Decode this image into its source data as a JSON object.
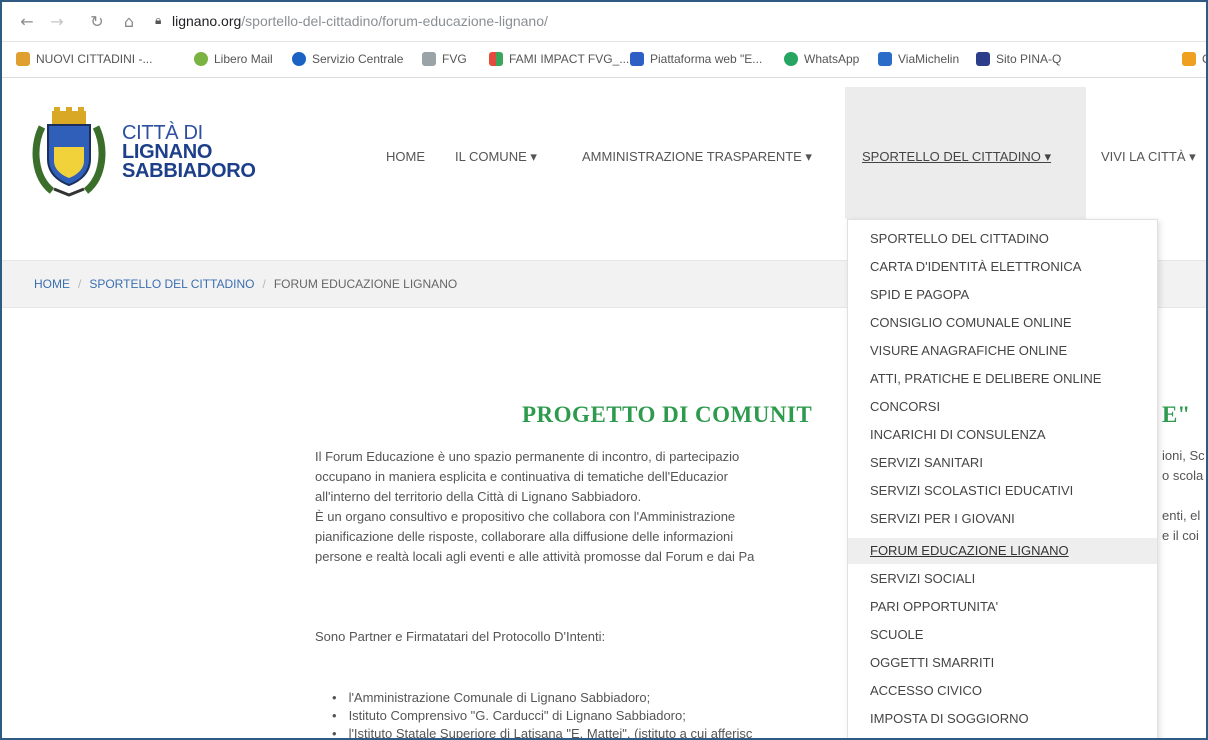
{
  "browser": {
    "back_icon": "arrow-left-icon",
    "forward_icon": "arrow-right-icon",
    "reload_icon": "reload-icon",
    "home_icon": "home-icon",
    "url_host": "lignano.org",
    "url_path": "/sportello-del-cittadino/forum-educazione-lignano/",
    "bookmarks": [
      {
        "label": "NUOVI CITTADINI -...",
        "color": "#e0a030"
      },
      {
        "label": "Libero Mail",
        "color": "#7bb342"
      },
      {
        "label": "Servizio Centrale",
        "color": "#1a63c4"
      },
      {
        "label": "FVG",
        "color": "#9aa3a8"
      },
      {
        "label": "FAMI IMPACT FVG_...",
        "color": "#e54b3c"
      },
      {
        "label": "Piattaforma web \"E...",
        "color": "#2d5fc4"
      },
      {
        "label": "WhatsApp",
        "color": "#25a55f"
      },
      {
        "label": "ViaMichelin",
        "color": "#2a6cc8"
      },
      {
        "label": "Sito PINA-Q",
        "color": "#2c3e8a"
      },
      {
        "label": "C",
        "color": "#f0a020"
      }
    ]
  },
  "site": {
    "logo_line1": "CITTÀ DI",
    "logo_line2": "LIGNANO",
    "logo_line3": "SABBIADORO",
    "menu": [
      {
        "label": "HOME"
      },
      {
        "label": "IL COMUNE ▾"
      },
      {
        "label": "AMMINISTRAZIONE TRASPARENTE ▾"
      },
      {
        "label": "SPORTELLO DEL CITTADINO ▾"
      },
      {
        "label": "VIVI LA CITTÀ ▾"
      }
    ]
  },
  "breadcrumb": {
    "home": "HOME",
    "section": "SPORTELLO DEL CITTADINO",
    "current": "FORUM EDUCAZIONE LIGNANO",
    "separator": "/"
  },
  "dropdown": {
    "items": [
      "SPORTELLO DEL CITTADINO",
      "CARTA D'IDENTITÀ ELETTRONICA",
      "SPID E PAGOPA",
      "CONSIGLIO COMUNALE ONLINE",
      "VISURE ANAGRAFICHE ONLINE",
      "ATTI, PRATICHE E DELIBERE ONLINE",
      "CONCORSI",
      "INCARICHI DI CONSULENZA",
      "SERVIZI SANITARI",
      "SERVIZI SCOLASTICI EDUCATIVI",
      "SERVIZI PER I GIOVANI",
      "FORUM EDUCAZIONE LIGNANO",
      "SERVIZI SOCIALI",
      "PARI OPPORTUNITA'",
      "SCUOLE",
      "OGGETTI SMARRITI",
      "ACCESSO CIVICO",
      "IMPOSTA DI SOGGIORNO"
    ],
    "active_index": 11
  },
  "content": {
    "heading_visible": "PROGETTO DI COMUNIT",
    "heading_tail": "E\"",
    "paragraph_lines": [
      "Il Forum Educazione è uno spazio permanente di incontro, di partecipazio",
      "occupano in maniera esplicita e continuativa di tematiche dell'Educazior",
      "all'interno del territorio della Città di Lignano Sabbiadoro.",
      "È un organo consultivo e propositivo che collabora con l'Amministrazione",
      "pianificazione delle risposte, collaborare alla diffusione delle informazioni",
      "persone e realtà locali agli eventi e alle attività promosse dal Forum e dai Pa"
    ],
    "paragraph_tails": [
      "ioni, Sc",
      "o scola",
      "",
      "enti, el",
      "e il coi",
      ""
    ],
    "partners_intro": "Sono Partner e Firmatatari del Protocollo D'Intenti:",
    "bullets": [
      "l'Amministrazione Comunale di Lignano Sabbiadoro;",
      "Istituto Comprensivo \"G. Carducci\" di Lignano Sabbiadoro;",
      "l'Istituto Statale Superiore di Latisana \"E. Mattei\", (istituto a cui afferisc"
    ]
  }
}
